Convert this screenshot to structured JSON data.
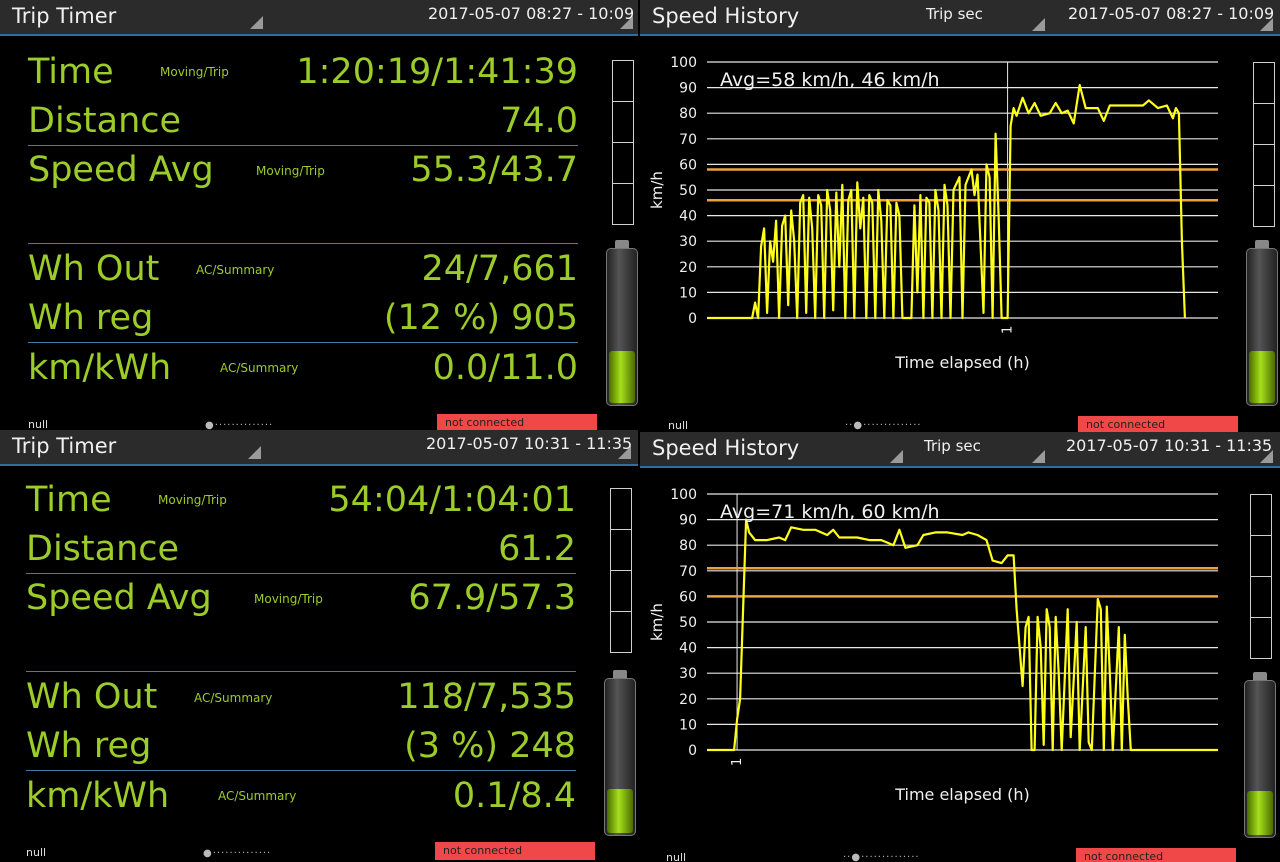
{
  "trip_panels": [
    {
      "title": "Trip Timer",
      "date_range": "2017-05-07 08:27 - 10:09",
      "rows": [
        {
          "label": "Time",
          "tag": "Moving/Trip",
          "value": "1:20:19/1:41:39"
        },
        {
          "label": "Distance",
          "tag": "",
          "value": "74.0"
        },
        {
          "label": "Speed Avg",
          "tag": "Moving/Trip",
          "value": "55.3/43.7"
        },
        {
          "label": "Wh Out",
          "tag": "AC/Summary",
          "value": "24/7,661"
        },
        {
          "label": "Wh reg",
          "tag": "",
          "value": "(12 %) 905"
        },
        {
          "label": "km/kWh",
          "tag": "AC/Summary",
          "value": "0.0/11.0"
        }
      ],
      "status_left": "null",
      "status_right": "not connected",
      "battery_level": 0.35
    },
    {
      "title": "Trip Timer",
      "date_range": "2017-05-07 10:31 - 11:35",
      "rows": [
        {
          "label": "Time",
          "tag": "Moving/Trip",
          "value": "54:04/1:04:01"
        },
        {
          "label": "Distance",
          "tag": "",
          "value": "61.2"
        },
        {
          "label": "Speed Avg",
          "tag": "Moving/Trip",
          "value": "67.9/57.3"
        },
        {
          "label": "Wh Out",
          "tag": "AC/Summary",
          "value": "118/7,535"
        },
        {
          "label": "Wh reg",
          "tag": "",
          "value": "(3 %) 248"
        },
        {
          "label": "km/kWh",
          "tag": "AC/Summary",
          "value": "0.1/8.4"
        }
      ],
      "status_left": "null",
      "status_right": "not connected",
      "battery_level": 0.28
    }
  ],
  "chart_panels": [
    {
      "title": "Speed History",
      "mode": "Trip sec",
      "date_range": "2017-05-07 08:27 - 10:09",
      "avg_text": "Avg=58 km/h, 46 km/h",
      "status_left": "null",
      "status_right": "not connected",
      "battery_level": 0.35
    },
    {
      "title": "Speed History",
      "mode": "Trip sec",
      "date_range": "2017-05-07 10:31 - 11:35",
      "avg_text": "Avg=71 km/h, 60 km/h",
      "status_left": "null",
      "status_right": "not connected",
      "battery_level": 0.28
    }
  ],
  "colors": {
    "accent": "#9ccc2a",
    "line": "#ffff1a",
    "avg_line": "#f0a040",
    "red": "#f04848",
    "divider": "#3f7fa8"
  },
  "chart_data": [
    {
      "type": "line",
      "xlabel": "Time elapsed (h)",
      "ylabel": "km/h",
      "ylim": [
        0,
        100
      ],
      "yticks": [
        0,
        10,
        20,
        30,
        40,
        50,
        60,
        70,
        80,
        90,
        100
      ],
      "xlim": [
        0,
        1.7
      ],
      "xticks": [
        1
      ],
      "xtick_labels": [
        "1"
      ],
      "grid": true,
      "avg_lines": [
        58,
        46
      ],
      "series": [
        {
          "values": [
            [
              0,
              0
            ],
            [
              0.15,
              0
            ],
            [
              0.16,
              6
            ],
            [
              0.17,
              0
            ],
            [
              0.18,
              28
            ],
            [
              0.19,
              35
            ],
            [
              0.2,
              2
            ],
            [
              0.21,
              30
            ],
            [
              0.22,
              22
            ],
            [
              0.23,
              38
            ],
            [
              0.24,
              0
            ],
            [
              0.25,
              36
            ],
            [
              0.26,
              40
            ],
            [
              0.27,
              5
            ],
            [
              0.28,
              42
            ],
            [
              0.29,
              30
            ],
            [
              0.3,
              0
            ],
            [
              0.31,
              45
            ],
            [
              0.32,
              48
            ],
            [
              0.33,
              2
            ],
            [
              0.34,
              47
            ],
            [
              0.35,
              35
            ],
            [
              0.36,
              0
            ],
            [
              0.37,
              48
            ],
            [
              0.38,
              44
            ],
            [
              0.39,
              0
            ],
            [
              0.4,
              50
            ],
            [
              0.41,
              42
            ],
            [
              0.42,
              3
            ],
            [
              0.43,
              49
            ],
            [
              0.44,
              20
            ],
            [
              0.45,
              52
            ],
            [
              0.46,
              0
            ],
            [
              0.47,
              46
            ],
            [
              0.48,
              50
            ],
            [
              0.49,
              0
            ],
            [
              0.5,
              53
            ],
            [
              0.51,
              35
            ],
            [
              0.52,
              47
            ],
            [
              0.53,
              0
            ],
            [
              0.54,
              48
            ],
            [
              0.55,
              45
            ],
            [
              0.56,
              0
            ],
            [
              0.57,
              50
            ],
            [
              0.58,
              38
            ],
            [
              0.59,
              0
            ],
            [
              0.6,
              46
            ],
            [
              0.61,
              44
            ],
            [
              0.62,
              0
            ],
            [
              0.63,
              45
            ],
            [
              0.64,
              40
            ],
            [
              0.65,
              0
            ],
            [
              0.68,
              0
            ],
            [
              0.69,
              44
            ],
            [
              0.7,
              10
            ],
            [
              0.71,
              48
            ],
            [
              0.72,
              0
            ],
            [
              0.73,
              47
            ],
            [
              0.74,
              45
            ],
            [
              0.75,
              0
            ],
            [
              0.76,
              50
            ],
            [
              0.77,
              42
            ],
            [
              0.78,
              0
            ],
            [
              0.79,
              52
            ],
            [
              0.8,
              44
            ],
            [
              0.81,
              0
            ],
            [
              0.82,
              50
            ],
            [
              0.84,
              55
            ],
            [
              0.85,
              0
            ],
            [
              0.86,
              52
            ],
            [
              0.88,
              58
            ],
            [
              0.89,
              48
            ],
            [
              0.9,
              56
            ],
            [
              0.92,
              2
            ],
            [
              0.93,
              60
            ],
            [
              0.94,
              55
            ],
            [
              0.95,
              0
            ],
            [
              0.96,
              72
            ],
            [
              0.97,
              40
            ],
            [
              0.98,
              0
            ],
            [
              1.0,
              0
            ],
            [
              1.01,
              75
            ],
            [
              1.02,
              82
            ],
            [
              1.03,
              79
            ],
            [
              1.05,
              86
            ],
            [
              1.07,
              80
            ],
            [
              1.09,
              84
            ],
            [
              1.11,
              79
            ],
            [
              1.14,
              80
            ],
            [
              1.16,
              84
            ],
            [
              1.18,
              80
            ],
            [
              1.2,
              81
            ],
            [
              1.22,
              76
            ],
            [
              1.24,
              91
            ],
            [
              1.26,
              82
            ],
            [
              1.3,
              82
            ],
            [
              1.32,
              77
            ],
            [
              1.34,
              83
            ],
            [
              1.45,
              83
            ],
            [
              1.47,
              85
            ],
            [
              1.5,
              82
            ],
            [
              1.53,
              83
            ],
            [
              1.55,
              78
            ],
            [
              1.56,
              82
            ],
            [
              1.57,
              80
            ],
            [
              1.58,
              30
            ],
            [
              1.59,
              0
            ]
          ]
        }
      ]
    },
    {
      "type": "line",
      "xlabel": "Time elapsed (h)",
      "ylabel": "km/h",
      "ylim": [
        0,
        100
      ],
      "yticks": [
        0,
        10,
        20,
        30,
        40,
        50,
        60,
        70,
        80,
        90,
        100
      ],
      "xlim": [
        0,
        1.7
      ],
      "xticks": [
        0.1
      ],
      "xtick_labels": [
        "1"
      ],
      "grid": true,
      "avg_lines": [
        71,
        60
      ],
      "series": [
        {
          "values": [
            [
              0,
              0
            ],
            [
              0.09,
              0
            ],
            [
              0.1,
              12
            ],
            [
              0.11,
              20
            ],
            [
              0.12,
              55
            ],
            [
              0.13,
              90
            ],
            [
              0.14,
              85
            ],
            [
              0.16,
              82
            ],
            [
              0.2,
              82
            ],
            [
              0.24,
              83
            ],
            [
              0.26,
              82
            ],
            [
              0.28,
              87
            ],
            [
              0.32,
              86
            ],
            [
              0.36,
              86
            ],
            [
              0.4,
              84
            ],
            [
              0.42,
              86
            ],
            [
              0.44,
              83
            ],
            [
              0.5,
              83
            ],
            [
              0.54,
              82
            ],
            [
              0.58,
              82
            ],
            [
              0.6,
              81
            ],
            [
              0.62,
              80
            ],
            [
              0.64,
              86
            ],
            [
              0.66,
              79
            ],
            [
              0.7,
              80
            ],
            [
              0.72,
              84
            ],
            [
              0.76,
              85
            ],
            [
              0.8,
              85
            ],
            [
              0.85,
              84
            ],
            [
              0.87,
              85
            ],
            [
              0.9,
              84
            ],
            [
              0.93,
              82
            ],
            [
              0.95,
              74
            ],
            [
              0.98,
              73
            ],
            [
              1.0,
              76
            ],
            [
              1.02,
              76
            ],
            [
              1.03,
              55
            ],
            [
              1.05,
              25
            ],
            [
              1.06,
              48
            ],
            [
              1.07,
              52
            ],
            [
              1.08,
              0
            ],
            [
              1.09,
              0
            ],
            [
              1.1,
              52
            ],
            [
              1.11,
              40
            ],
            [
              1.12,
              2
            ],
            [
              1.13,
              55
            ],
            [
              1.14,
              48
            ],
            [
              1.15,
              0
            ],
            [
              1.16,
              52
            ],
            [
              1.17,
              30
            ],
            [
              1.18,
              0
            ],
            [
              1.2,
              55
            ],
            [
              1.21,
              5
            ],
            [
              1.23,
              50
            ],
            [
              1.24,
              0
            ],
            [
              1.26,
              48
            ],
            [
              1.27,
              3
            ],
            [
              1.28,
              0
            ],
            [
              1.3,
              59
            ],
            [
              1.31,
              55
            ],
            [
              1.32,
              0
            ],
            [
              1.33,
              56
            ],
            [
              1.34,
              30
            ],
            [
              1.35,
              0
            ],
            [
              1.37,
              48
            ],
            [
              1.38,
              0
            ],
            [
              1.39,
              45
            ],
            [
              1.4,
              20
            ],
            [
              1.41,
              0
            ],
            [
              1.43,
              0
            ],
            [
              1.7,
              0
            ]
          ]
        }
      ]
    }
  ]
}
